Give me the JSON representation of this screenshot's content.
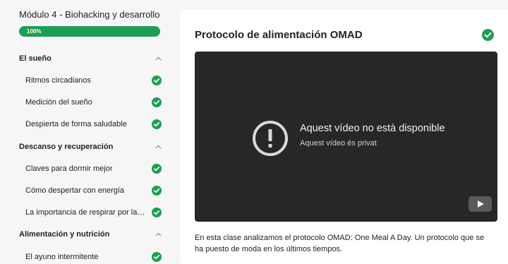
{
  "sidebar": {
    "module_title": "Módulo 4 - Biohacking y desarrollo",
    "progress": {
      "label": "100%",
      "value": 1.0
    },
    "sections": [
      {
        "label": "El sueño",
        "expanded": true,
        "lessons": [
          {
            "label": "Ritmos circadianos",
            "completed": true
          },
          {
            "label": "Medición del sueño",
            "completed": true
          },
          {
            "label": "Despierta de forma saludable",
            "completed": true
          }
        ]
      },
      {
        "label": "Descanso y recuperación",
        "expanded": true,
        "lessons": [
          {
            "label": "Claves para dormir mejor",
            "completed": true
          },
          {
            "label": "Cómo despertar con energía",
            "completed": true
          },
          {
            "label": "La importancia de respirar por la n...",
            "completed": true
          }
        ]
      },
      {
        "label": "Alimentación y nutrición",
        "expanded": true,
        "lessons": [
          {
            "label": "El ayuno intermitente",
            "completed": true
          }
        ]
      }
    ]
  },
  "main": {
    "title": "Protocolo de alimentación OMAD",
    "completed": true,
    "video": {
      "error_title": "Aquest vídeo no està disponible",
      "error_subtitle": "Aquest vídeo és privat",
      "icons": [
        "alert-circle-icon",
        "youtube-icon"
      ]
    },
    "description": "En esta clase analizamos el protocolo OMAD: One Meal A Day. Un protocolo que se ha puesto de moda en los últimos tiempos."
  },
  "colors": {
    "accent_green": "#1f9d55",
    "video_bg": "#272727",
    "page_bg": "#f6f6f6"
  }
}
